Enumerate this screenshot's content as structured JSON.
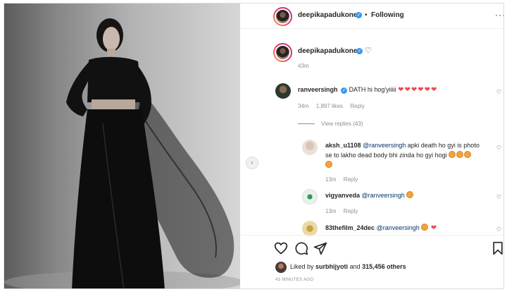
{
  "post_author": {
    "username": "deepikapadukone",
    "follow_status": "Following"
  },
  "caption": {
    "username": "deepikapadukone",
    "time": "43m"
  },
  "top_comment": {
    "username": "ranveersingh",
    "text": "DATH hi hog'yiiiii",
    "hearts": "❤❤❤❤❤❤",
    "time": "34m",
    "likes": "1,897 likes",
    "reply_label": "Reply"
  },
  "view_replies_label": "View replies (43)",
  "replies": [
    {
      "username": "aksh_u1108",
      "mention": "@ranveersingh",
      "text_line1": "apki death ho gyi is photo",
      "text_line2": "se to lakho dead body bhi zinda ho gyi hogi",
      "time": "13m",
      "reply_label": "Reply"
    },
    {
      "username": "vigyanveda",
      "mention": "@ranveersingh",
      "time": "13m",
      "reply_label": "Reply"
    },
    {
      "username": "83thefilm_24dec",
      "mention": "@ranveersingh",
      "heart": "❤"
    }
  ],
  "likes_summary": {
    "prefix": "Liked by",
    "user": "surbhijyoti",
    "and_text": "and",
    "others": "315,456 others"
  },
  "timestamp": "43 MINUTES AGO",
  "icons": [
    "more-options-icon",
    "heart-icon",
    "comment-icon",
    "share-icon",
    "bookmark-icon",
    "verified-badge-icon",
    "next-arrow-icon"
  ],
  "colors": {
    "link": "#00376b",
    "verified": "#3897f0",
    "heart": "#ed4956",
    "muted": "#8e8e8e"
  }
}
